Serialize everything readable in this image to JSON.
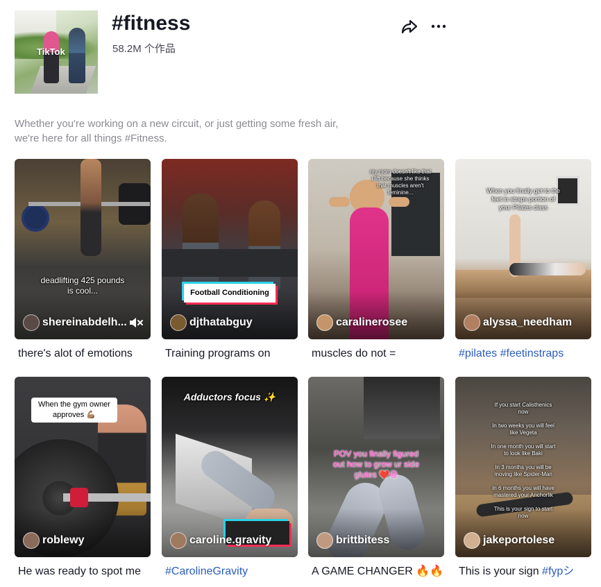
{
  "header": {
    "title": "#fitness",
    "count": "58.2M 个作品",
    "cover_logo": "TikTok"
  },
  "description": "Whether you're working on a new circuit, or just getting some fresh air,\nwe're here for all things #Fitness.",
  "videos": [
    {
      "username": "shereinabdelh...",
      "overlay": "deadlifting 425 pounds\nis cool...",
      "caption": "there's alot of emotions",
      "caption_tag": "",
      "muted": true,
      "colors": {
        "bg1": "#3b3a38",
        "bg2": "#6a6452",
        "avatar": "#5a4a46"
      }
    },
    {
      "username": "djthatabguy",
      "overlay": "Football Conditioning",
      "caption": "Training programs on",
      "caption_tag": "",
      "colors": {
        "bg1": "#8b2a22",
        "bg2": "#3b3f49",
        "avatar": "#7a5a30"
      }
    },
    {
      "username": "caralinerosee",
      "overlay": "my mom doesn't like that\ni lift because she thinks\nthat muscles aren't\nfeminine...",
      "caption": "muscles do not =",
      "caption_tag": "",
      "colors": {
        "bg1": "#c9c2b6",
        "bg2": "#8e7a6a",
        "avatar": "#c4956a"
      }
    },
    {
      "username": "alyssa_needham",
      "overlay": "When you finally get to the\nfeet in straps portion of\nyour Pilates class",
      "caption": "",
      "caption_tag": "#pilates #feetinstraps",
      "colors": {
        "bg1": "#e6e4df",
        "bg2": "#a58868",
        "avatar": "#b08060"
      }
    },
    {
      "username": "roblewy",
      "overlay": "When the gym owner\napproves 💪🏽",
      "caption": "He was ready to spot me",
      "caption_tag": "",
      "colors": {
        "bg1": "#3a3a3c",
        "bg2": "#1b1b1d",
        "avatar": "#8a6a5a"
      }
    },
    {
      "username": "caroline.gravity",
      "overlay": "Adductors focus ✨",
      "caption": "",
      "caption_tag": "#CarolineGravity",
      "colors": {
        "bg1": "#2b2b2e",
        "bg2": "#c8c8c6",
        "avatar": "#a07a60"
      }
    },
    {
      "username": "brittbitess",
      "overlay": "POV you finally figured\nout how to grow ur side\nglutes ❤️😀",
      "caption": "A GAME CHANGER 🔥🔥",
      "caption_tag": "",
      "colors": {
        "bg1": "#5a5a55",
        "bg2": "#9a9a96",
        "avatar": "#c09a80"
      }
    },
    {
      "username": "jakeportolese",
      "overlay": "If you start Calisthenics\nnow\n\nIn two weeks you will feel\nlike Vegeta\n\nIn one month you will start\nto look like Baki\n\nIn 3 months you will be\nmoving like Spider-Man\n\nIn 6 months you will have\nmastered your Anchorlik\n\nThis is your sign to start\nnow",
      "caption": "This is your sign ",
      "caption_tag": "#fypシ",
      "colors": {
        "bg1": "#9a7e5e",
        "bg2": "#3e3a36",
        "avatar": "#d0b090"
      }
    }
  ]
}
